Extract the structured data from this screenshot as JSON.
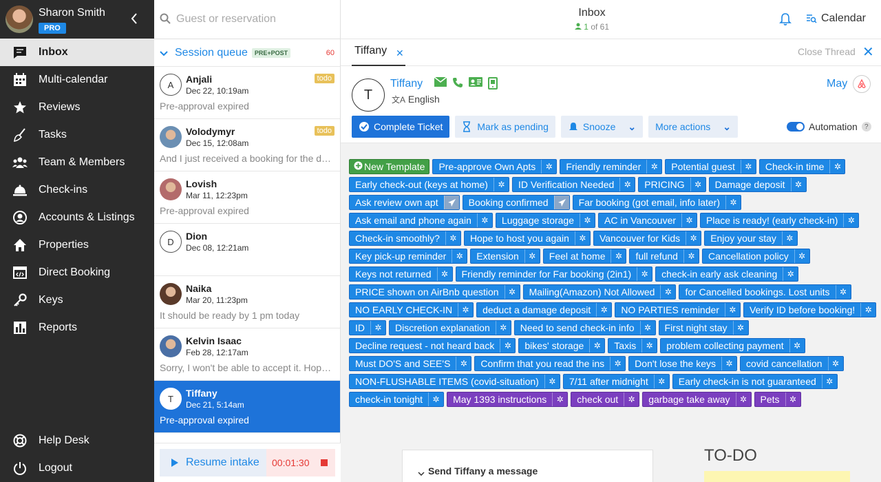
{
  "sidebar": {
    "user_name": "Sharon Smith",
    "badge": "PRO",
    "items": [
      {
        "label": "Inbox",
        "icon": "inbox-icon",
        "active": true
      },
      {
        "label": "Multi-calendar",
        "icon": "calendar-grid-icon"
      },
      {
        "label": "Reviews",
        "icon": "star-icon"
      },
      {
        "label": "Tasks",
        "icon": "broom-icon"
      },
      {
        "label": "Team & Members",
        "icon": "people-icon"
      },
      {
        "label": "Check-ins",
        "icon": "bell-icon"
      },
      {
        "label": "Accounts & Listings",
        "icon": "account-icon"
      },
      {
        "label": "Properties",
        "icon": "home-icon"
      },
      {
        "label": "Direct Booking",
        "icon": "code-window-icon"
      },
      {
        "label": "Keys",
        "icon": "key-icon"
      },
      {
        "label": "Reports",
        "icon": "bar-chart-icon"
      }
    ],
    "bottom_items": [
      {
        "label": "Help Desk",
        "icon": "lifebuoy-icon"
      },
      {
        "label": "Logout",
        "icon": "power-icon"
      }
    ]
  },
  "convlist": {
    "search_placeholder": "Guest or reservation",
    "queue_title": "Session queue",
    "queue_tag": "PRE+POST",
    "queue_count": "60",
    "conversations": [
      {
        "initial": "A",
        "name": "Anjali",
        "date": "Dec 22, 10:19am",
        "preview": "Pre-approval expired",
        "todo": "todo"
      },
      {
        "initial": "",
        "name": "Volodymyr",
        "date": "Dec 15, 12:08am",
        "preview": "And I just received a booking for the dates...",
        "todo": "todo"
      },
      {
        "initial": "",
        "name": "Lovish",
        "date": "Mar 11, 12:23pm",
        "preview": "Pre-approval expired",
        "todo": ""
      },
      {
        "initial": "D",
        "name": "Dion",
        "date": "Dec 08, 12:21am",
        "preview": "",
        "todo": ""
      },
      {
        "initial": "",
        "name": "Naika",
        "date": "Mar 20, 11:23pm",
        "preview": "It should be ready by 1 pm today",
        "todo": ""
      },
      {
        "initial": "",
        "name": "Kelvin Isaac",
        "date": "Feb 28, 12:17am",
        "preview": "Sorry, I won't be able to accept it. Hope you...",
        "todo": ""
      },
      {
        "initial": "T",
        "name": "Tiffany",
        "date": "Dec 21, 5:14am",
        "preview": "Pre-approval expired",
        "todo": ""
      }
    ],
    "resume_label": "Resume intake",
    "timer": "00:01:30"
  },
  "header": {
    "title": "Inbox",
    "count_current": "1",
    "count_text": "of 61",
    "calendar_label": "Calendar"
  },
  "thread": {
    "tab_label": "Tiffany",
    "close_thread": "Close Thread",
    "guest_initial": "T",
    "guest_name": "Tiffany",
    "language": "English",
    "month": "May",
    "actions": {
      "complete": "Complete Ticket",
      "pending": "Mark as pending",
      "snooze": "Snooze",
      "more": "More actions"
    },
    "automation_label": "Automation"
  },
  "templates": [
    [
      {
        "label": "New Template",
        "kind": "green"
      },
      {
        "label": "Pre-approve Own Apts"
      },
      {
        "label": "Friendly reminder"
      },
      {
        "label": "Potential guest"
      },
      {
        "label": "Check-in time"
      }
    ],
    [
      {
        "label": "Early check-out (keys at home)"
      },
      {
        "label": "ID Verification Needed"
      },
      {
        "label": "PRICING"
      },
      {
        "label": "Damage deposit"
      }
    ],
    [
      {
        "label": "Ask review own apt",
        "kind": "plane"
      },
      {
        "label": "Booking confirmed",
        "kind": "plane"
      },
      {
        "label": "Far booking (got email, info later)"
      }
    ],
    [
      {
        "label": "Ask email and phone again"
      },
      {
        "label": "Luggage storage"
      },
      {
        "label": "AC in Vancouver"
      },
      {
        "label": "Place is ready! (early check-in)"
      }
    ],
    [
      {
        "label": "Check-in smoothly?"
      },
      {
        "label": "Hope to host you again"
      },
      {
        "label": "Vancouver for Kids"
      },
      {
        "label": "Enjoy your stay"
      }
    ],
    [
      {
        "label": "Key pick-up reminder"
      },
      {
        "label": "Extension"
      },
      {
        "label": "Feel at home"
      },
      {
        "label": "full refund"
      },
      {
        "label": "Cancellation policy"
      }
    ],
    [
      {
        "label": "Keys not returned"
      },
      {
        "label": "Friendly reminder for Far booking (2in1)"
      },
      {
        "label": "check-in early ask cleaning"
      }
    ],
    [
      {
        "label": "PRICE shown on AirBnb question"
      },
      {
        "label": "Mailing(Amazon) Not Allowed"
      },
      {
        "label": "for Cancelled bookings. Lost units"
      }
    ],
    [
      {
        "label": "NO EARLY CHECK-IN"
      },
      {
        "label": "deduct a damage deposit"
      },
      {
        "label": "NO PARTIES reminder"
      },
      {
        "label": "Verify ID before booking!"
      }
    ],
    [
      {
        "label": "ID"
      },
      {
        "label": "Discretion explanation"
      },
      {
        "label": "Need to send check-in info"
      },
      {
        "label": "First night stay"
      }
    ],
    [
      {
        "label": "Decline request - not heard back"
      },
      {
        "label": "bikes' storage"
      },
      {
        "label": "Taxis"
      },
      {
        "label": "problem collecting payment"
      }
    ],
    [
      {
        "label": "Must DO'S and SEE'S"
      },
      {
        "label": "Confirm that you read the ins"
      },
      {
        "label": "Don't lose the keys"
      },
      {
        "label": "covid cancellation"
      }
    ],
    [
      {
        "label": "NON-FLUSHABLE ITEMS (covid-situation)"
      },
      {
        "label": "7/11 after midnight"
      },
      {
        "label": "Early check-in is not guaranteed"
      }
    ],
    [
      {
        "label": "check-in tonight"
      },
      {
        "label": "May 1393 instructions",
        "kind": "purple"
      },
      {
        "label": "check out",
        "kind": "purple"
      },
      {
        "label": "garbage take away",
        "kind": "purple"
      },
      {
        "label": "Pets",
        "kind": "purple"
      }
    ]
  ],
  "bottom": {
    "send_title": "Send Tiffany a message",
    "todo_title": "TO-DO"
  }
}
